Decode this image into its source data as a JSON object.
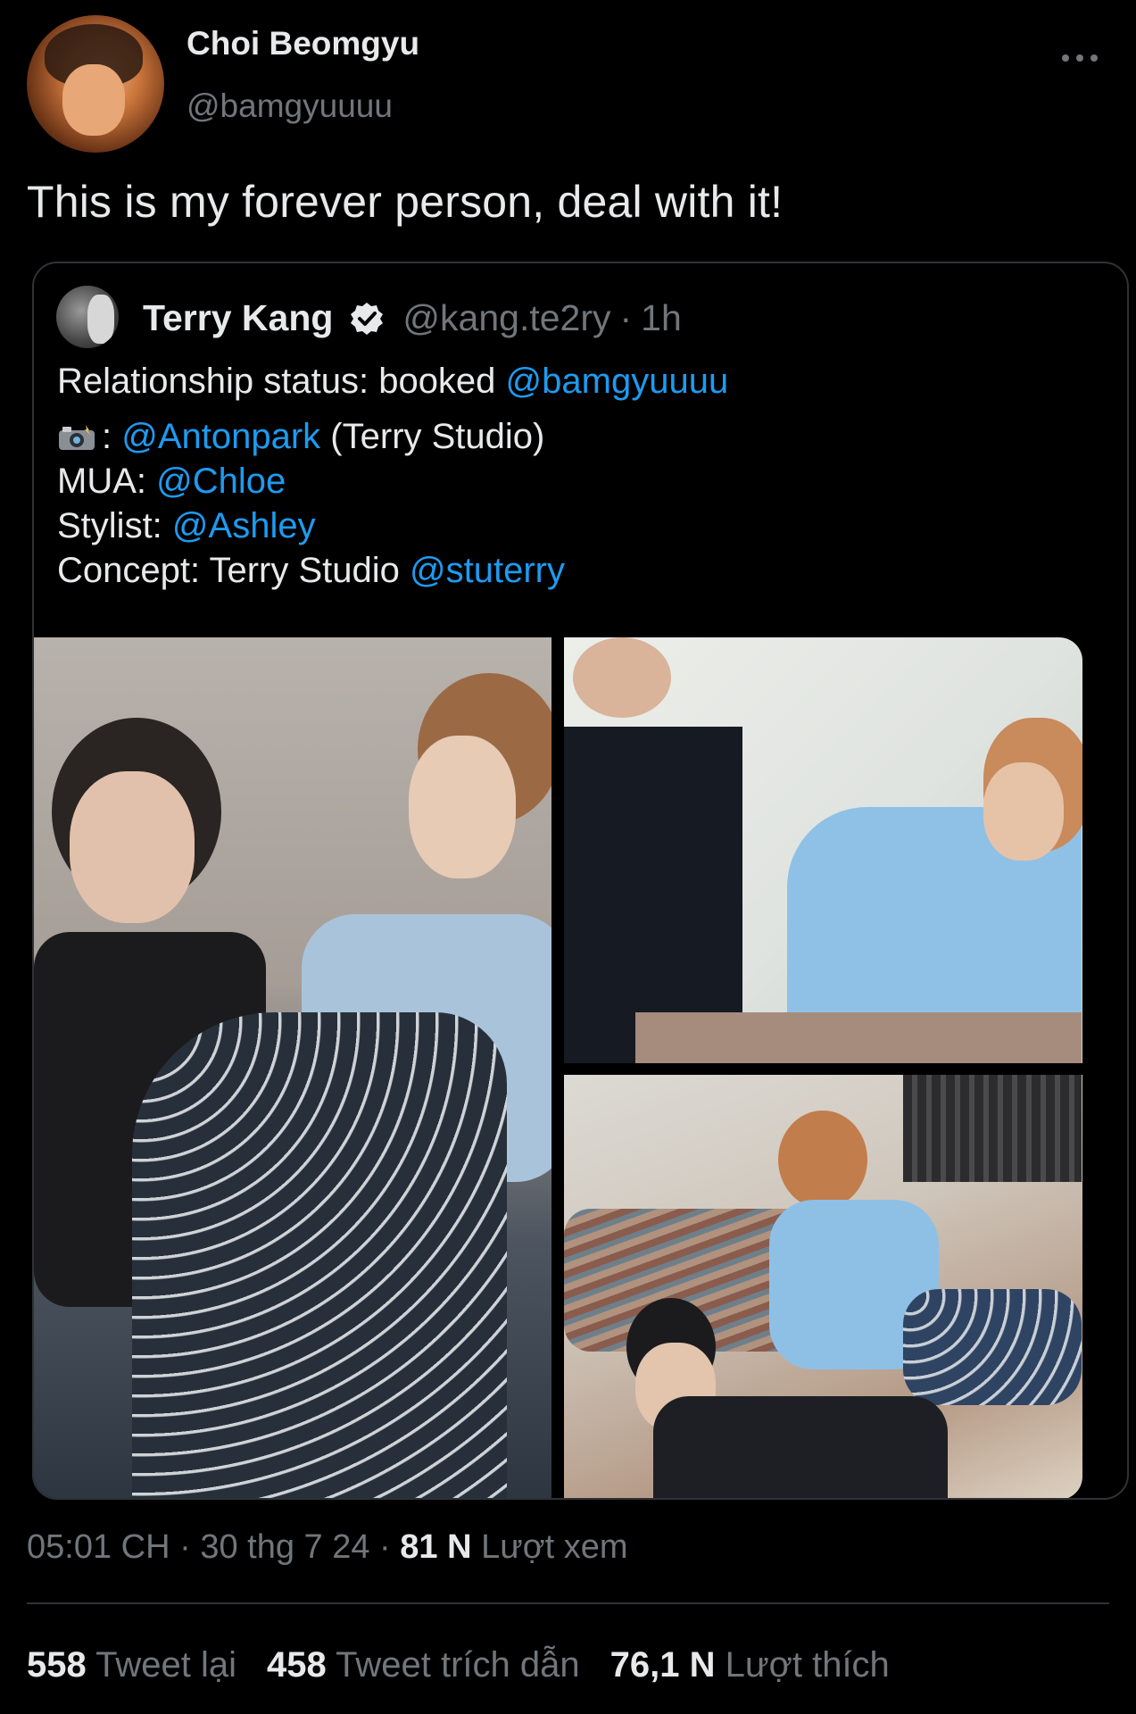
{
  "tweet": {
    "author_name": "Choi Beomgyu",
    "author_handle": "@bamgyuuuu",
    "text": "This is my forever person, deal with it!"
  },
  "quoted_tweet": {
    "author_name": "Terry Kang",
    "verified_icon": "verified-badge-icon",
    "author_handle": "@kang.te2ry",
    "separator": "·",
    "time": "1h",
    "line1_text": "Relationship status: booked ",
    "line1_mention": "@bamgyuuuu",
    "camera_icon": "camera-flash-emoji",
    "line2_prefix": ": ",
    "line2_mention": "@Antonpark",
    "line2_suffix": " (Terry Studio)",
    "line3_text": "MUA: ",
    "line3_mention": "@Chloe",
    "line4_text": "Stylist: ",
    "line4_mention": "@Ashley",
    "line5_text": "Concept: Terry Studio ",
    "line5_mention": "@stuterry"
  },
  "meta": {
    "time": "05:01 CH",
    "sep1": " · ",
    "date": "30 thg 7 24",
    "sep2": " · ",
    "views_count": "81 N",
    "views_label": " Lượt xem"
  },
  "counts": {
    "retweets_count": "558",
    "retweets_label": " Tweet lại",
    "quotes_count": "458",
    "quotes_label": " Tweet trích dẫn",
    "likes_count": "76,1 N",
    "likes_label": " Lượt thích"
  },
  "colors": {
    "background": "#000000",
    "text": "#e7e9ea",
    "muted": "#71767b",
    "link": "#1d9bf0",
    "border": "#2f3336"
  }
}
